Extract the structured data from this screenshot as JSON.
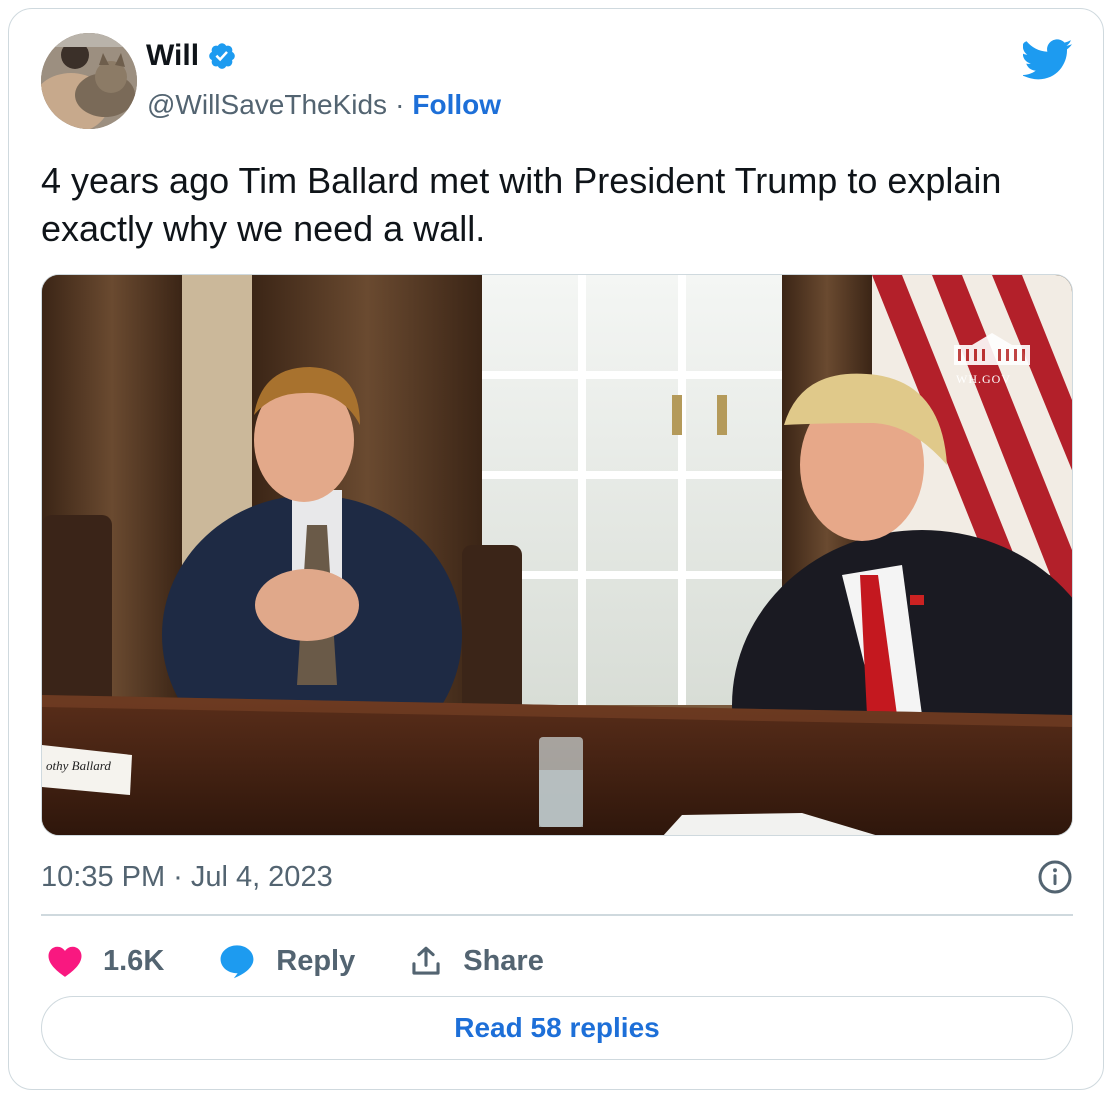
{
  "user": {
    "name": "Will",
    "verified": true,
    "handle": "@WillSaveTheKids",
    "separator": "·",
    "follow_label": "Follow"
  },
  "tweet": {
    "text": "4 years ago Tim Ballard met with President Trump to explain exactly why we need a wall.",
    "media": {
      "watermark": "WH.GOV",
      "nameplate": "othy Ballard"
    },
    "time": "10:35 PM",
    "separator": "·",
    "date": "Jul 4, 2023"
  },
  "actions": {
    "like_count": "1.6K",
    "reply_label": "Reply",
    "share_label": "Share"
  },
  "read_replies_label": "Read 58 replies",
  "colors": {
    "accent": "#1d9bf0",
    "link": "#1d6fd8",
    "like": "#f91880",
    "text": "#0f1419",
    "secondary": "#536471",
    "border": "#cfd9de"
  },
  "icons": [
    "verified-badge-icon",
    "twitter-bird-icon",
    "info-icon",
    "heart-icon",
    "reply-bubble-icon",
    "share-icon"
  ]
}
